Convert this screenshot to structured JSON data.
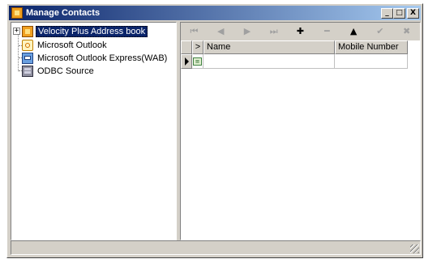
{
  "window": {
    "title": "Manage Contacts",
    "buttons": {
      "minimize": "_",
      "maximize": "□",
      "close": "X"
    }
  },
  "tree": {
    "items": [
      {
        "label": "Velocity Plus Address book",
        "icon": "velocity-book-icon",
        "expander": "+",
        "selected": true
      },
      {
        "label": "Microsoft Outlook",
        "icon": "outlook-icon",
        "selected": false
      },
      {
        "label": "Microsoft Outlook Express(WAB)",
        "icon": "outlook-express-icon",
        "selected": false
      },
      {
        "label": "ODBC Source",
        "icon": "odbc-icon",
        "selected": false
      }
    ]
  },
  "navigator": {
    "buttons": [
      {
        "glyph": "⏮",
        "name": "first",
        "enabled": false
      },
      {
        "glyph": "◀",
        "name": "prior",
        "enabled": false
      },
      {
        "glyph": "▶",
        "name": "next",
        "enabled": false
      },
      {
        "glyph": "⏭",
        "name": "last",
        "enabled": false
      },
      {
        "glyph": "✚",
        "name": "insert",
        "enabled": true
      },
      {
        "glyph": "━",
        "name": "delete",
        "enabled": false
      },
      {
        "glyph": "▲",
        "name": "edit",
        "enabled": true
      },
      {
        "glyph": "✔",
        "name": "post",
        "enabled": false
      },
      {
        "glyph": "✖",
        "name": "cancel",
        "enabled": false
      }
    ]
  },
  "grid": {
    "header": {
      "expand_col": ">",
      "name": "Name",
      "mobile": "Mobile Number"
    },
    "rows": [
      {
        "expand_glyph": "≡",
        "name": "",
        "mobile": ""
      }
    ]
  },
  "statusbar": {
    "text": ""
  },
  "colors": {
    "titlebar_start": "#0a246a",
    "titlebar_end": "#a6caf0",
    "face": "#d4d0c8",
    "selection": "#0a246a"
  }
}
